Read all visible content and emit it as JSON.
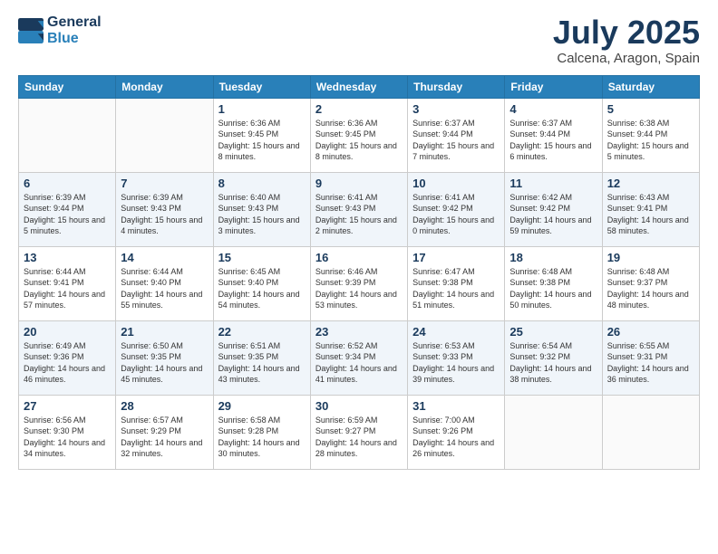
{
  "header": {
    "logo_line1": "General",
    "logo_line2": "Blue",
    "month_title": "July 2025",
    "location": "Calcena, Aragon, Spain"
  },
  "weekdays": [
    "Sunday",
    "Monday",
    "Tuesday",
    "Wednesday",
    "Thursday",
    "Friday",
    "Saturday"
  ],
  "weeks": [
    [
      {
        "day": "",
        "info": ""
      },
      {
        "day": "",
        "info": ""
      },
      {
        "day": "1",
        "info": "Sunrise: 6:36 AM\nSunset: 9:45 PM\nDaylight: 15 hours and 8 minutes."
      },
      {
        "day": "2",
        "info": "Sunrise: 6:36 AM\nSunset: 9:45 PM\nDaylight: 15 hours and 8 minutes."
      },
      {
        "day": "3",
        "info": "Sunrise: 6:37 AM\nSunset: 9:44 PM\nDaylight: 15 hours and 7 minutes."
      },
      {
        "day": "4",
        "info": "Sunrise: 6:37 AM\nSunset: 9:44 PM\nDaylight: 15 hours and 6 minutes."
      },
      {
        "day": "5",
        "info": "Sunrise: 6:38 AM\nSunset: 9:44 PM\nDaylight: 15 hours and 5 minutes."
      }
    ],
    [
      {
        "day": "6",
        "info": "Sunrise: 6:39 AM\nSunset: 9:44 PM\nDaylight: 15 hours and 5 minutes."
      },
      {
        "day": "7",
        "info": "Sunrise: 6:39 AM\nSunset: 9:43 PM\nDaylight: 15 hours and 4 minutes."
      },
      {
        "day": "8",
        "info": "Sunrise: 6:40 AM\nSunset: 9:43 PM\nDaylight: 15 hours and 3 minutes."
      },
      {
        "day": "9",
        "info": "Sunrise: 6:41 AM\nSunset: 9:43 PM\nDaylight: 15 hours and 2 minutes."
      },
      {
        "day": "10",
        "info": "Sunrise: 6:41 AM\nSunset: 9:42 PM\nDaylight: 15 hours and 0 minutes."
      },
      {
        "day": "11",
        "info": "Sunrise: 6:42 AM\nSunset: 9:42 PM\nDaylight: 14 hours and 59 minutes."
      },
      {
        "day": "12",
        "info": "Sunrise: 6:43 AM\nSunset: 9:41 PM\nDaylight: 14 hours and 58 minutes."
      }
    ],
    [
      {
        "day": "13",
        "info": "Sunrise: 6:44 AM\nSunset: 9:41 PM\nDaylight: 14 hours and 57 minutes."
      },
      {
        "day": "14",
        "info": "Sunrise: 6:44 AM\nSunset: 9:40 PM\nDaylight: 14 hours and 55 minutes."
      },
      {
        "day": "15",
        "info": "Sunrise: 6:45 AM\nSunset: 9:40 PM\nDaylight: 14 hours and 54 minutes."
      },
      {
        "day": "16",
        "info": "Sunrise: 6:46 AM\nSunset: 9:39 PM\nDaylight: 14 hours and 53 minutes."
      },
      {
        "day": "17",
        "info": "Sunrise: 6:47 AM\nSunset: 9:38 PM\nDaylight: 14 hours and 51 minutes."
      },
      {
        "day": "18",
        "info": "Sunrise: 6:48 AM\nSunset: 9:38 PM\nDaylight: 14 hours and 50 minutes."
      },
      {
        "day": "19",
        "info": "Sunrise: 6:48 AM\nSunset: 9:37 PM\nDaylight: 14 hours and 48 minutes."
      }
    ],
    [
      {
        "day": "20",
        "info": "Sunrise: 6:49 AM\nSunset: 9:36 PM\nDaylight: 14 hours and 46 minutes."
      },
      {
        "day": "21",
        "info": "Sunrise: 6:50 AM\nSunset: 9:35 PM\nDaylight: 14 hours and 45 minutes."
      },
      {
        "day": "22",
        "info": "Sunrise: 6:51 AM\nSunset: 9:35 PM\nDaylight: 14 hours and 43 minutes."
      },
      {
        "day": "23",
        "info": "Sunrise: 6:52 AM\nSunset: 9:34 PM\nDaylight: 14 hours and 41 minutes."
      },
      {
        "day": "24",
        "info": "Sunrise: 6:53 AM\nSunset: 9:33 PM\nDaylight: 14 hours and 39 minutes."
      },
      {
        "day": "25",
        "info": "Sunrise: 6:54 AM\nSunset: 9:32 PM\nDaylight: 14 hours and 38 minutes."
      },
      {
        "day": "26",
        "info": "Sunrise: 6:55 AM\nSunset: 9:31 PM\nDaylight: 14 hours and 36 minutes."
      }
    ],
    [
      {
        "day": "27",
        "info": "Sunrise: 6:56 AM\nSunset: 9:30 PM\nDaylight: 14 hours and 34 minutes."
      },
      {
        "day": "28",
        "info": "Sunrise: 6:57 AM\nSunset: 9:29 PM\nDaylight: 14 hours and 32 minutes."
      },
      {
        "day": "29",
        "info": "Sunrise: 6:58 AM\nSunset: 9:28 PM\nDaylight: 14 hours and 30 minutes."
      },
      {
        "day": "30",
        "info": "Sunrise: 6:59 AM\nSunset: 9:27 PM\nDaylight: 14 hours and 28 minutes."
      },
      {
        "day": "31",
        "info": "Sunrise: 7:00 AM\nSunset: 9:26 PM\nDaylight: 14 hours and 26 minutes."
      },
      {
        "day": "",
        "info": ""
      },
      {
        "day": "",
        "info": ""
      }
    ]
  ]
}
